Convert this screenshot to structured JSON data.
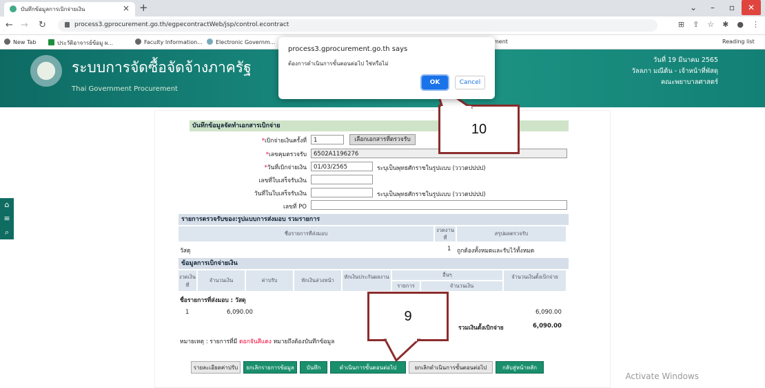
{
  "browser": {
    "tab_title": "บันทึกข้อมูลการเบิกจ่ายเงิน",
    "url": "process3.gprocurement.go.th/egpecontractWeb/jsp/control.econtract",
    "bookmarks": [
      "New Tab",
      "ประวัติอาจารย์ข้อมู ผ...",
      "Faculty Information...",
      "Electronic Governm...",
      "ment"
    ],
    "reading_list": "Reading list"
  },
  "banner": {
    "title": "ระบบการจัดซื้อจัดจ้างภาครัฐ",
    "subtitle": "Thai Government Procurement",
    "date": "วันที่ 19 มีนาคม 2565",
    "user": "วัลลภา มณีต้น - เจ้าหน้าที่พัสดุ",
    "org": "คณะพยาบาลศาสตร์"
  },
  "dialog": {
    "title": "process3.gprocurement.go.th says",
    "message": "ต้องการดำเนินการขั้นตอนต่อไป ใช่หรือไม่",
    "ok": "OK",
    "cancel": "Cancel"
  },
  "form": {
    "section_title": "บันทึกข้อมูลจัดทำเอกสารเบิกจ่าย",
    "installment_label": "เบิกจ่ายเงินครั้งที่",
    "installment_value": "1",
    "select_doc_button": "เลือกเอกสารที่ตรวจรับ",
    "inspection_no_label": "เลขคุมตรวจรับ",
    "inspection_no_value": "6502A1196276",
    "pay_date_label": "วันที่เบิกจ่ายเงิน",
    "pay_date_value": "01/03/2565",
    "pay_date_hint": "ระบุเป็นพุทธศักราชในรูปแบบ (วววดปปปป)",
    "receipt_no_label": "เลขที่ใบเสร็จรับเงิน",
    "receipt_date_label": "วันที่ในใบเสร็จรับเงิน",
    "receipt_date_hint": "ระบุเป็นพุทธศักราชในรูปแบบ (วววดปปปป)",
    "po_label": "เลขที่ PO"
  },
  "inspection": {
    "section_title": "รายการตรวจรับของ:รูปแบบการส่งมอบ รวมรายการ",
    "col_item": "ชื่อรายการที่ส่งมอบ",
    "col_period": "งวดงานที่",
    "col_result": "สรุปผลตรวจรับ",
    "row_item": "วัสดุ",
    "row_period": "1",
    "row_result": "ถูกต้องทั้งหมดและรับไว้ทั้งหมด"
  },
  "payment": {
    "section_title": "ข้อมูลการเบิกจ่ายเงิน",
    "col_period": "งวดเงินที่",
    "col_amount": "จำนวนเงิน",
    "col_fine": "ค่าปรับ",
    "col_advance": "หักเงินล่วงหน้า",
    "col_guarantee": "หักเงินประกันผลงาน",
    "col_other": "อื่นๆ",
    "col_other_item": "รายการ",
    "col_other_amount": "จำนวนเงิน",
    "col_total": "จำนวนเงินตั้งเบิกจ่าย",
    "item_label": "ชื่อรายการที่ส่งมอบ : วัสดุ",
    "row_period": "1",
    "row_amount": "6,090.00",
    "row_total": "6,090.00",
    "sum_label": "รวมเงินตั้งเบิกจ่าย",
    "sum_value": "6,090.00",
    "note_prefix": "หมายเหตุ : รายการที่มี",
    "note_red": "ดอกจันสีแดง",
    "note_suffix": "หมายถึงต้องบันทึกข้อมูล"
  },
  "buttons": {
    "fine_detail": "รายละเอียดค่าปรับ",
    "cancel_items": "ยกเลิกรายการข้อมูล",
    "save": "บันทึก",
    "next_step": "ดำเนินการขั้นตอนต่อไป",
    "cancel_next": "ยกเลิกดำเนินการขั้นตอนต่อไป",
    "home": "กลับสู่หน้าหลัก"
  },
  "callouts": {
    "step9": "9",
    "step10": "10"
  },
  "watermark": "Activate Windows"
}
